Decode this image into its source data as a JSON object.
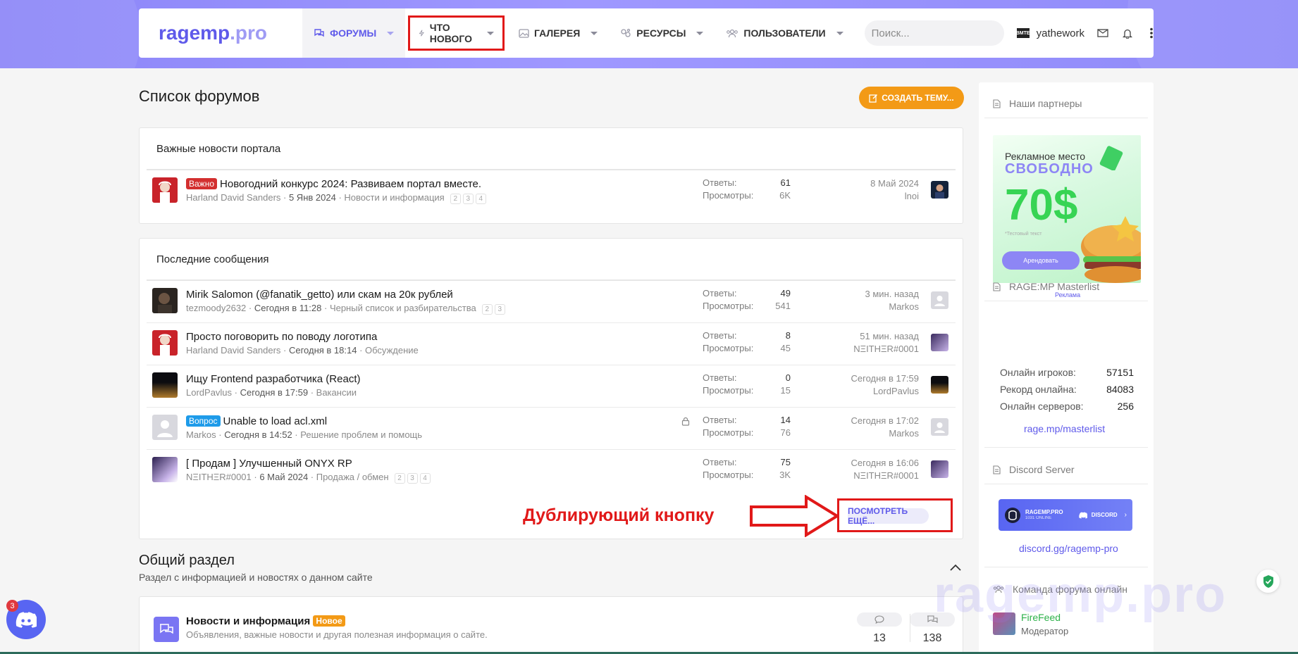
{
  "brand": {
    "logo_main": "ragemp",
    "logo_dot": ".pro",
    "accent": "#5f5aea",
    "orange": "#f39a16",
    "annotation_red": "#e11919"
  },
  "nav": {
    "items": [
      {
        "label": "ФОРУМЫ",
        "icon": "forums-icon"
      },
      {
        "label": "ЧТО НОВОГО",
        "icon": "lightning-icon"
      },
      {
        "label": "ГАЛЕРЕЯ",
        "icon": "gallery-icon"
      },
      {
        "label": "РЕСУРСЫ",
        "icon": "resources-icon"
      },
      {
        "label": "ПОЛЬЗОВАТЕЛИ",
        "icon": "users-icon"
      }
    ],
    "search_placeholder": "Поиск...",
    "username": "yathework",
    "user_avatar_text": "BMTE"
  },
  "page": {
    "title": "Список форумов",
    "create_button": "СОЗДАТЬ ТЕМУ..."
  },
  "important": {
    "heading": "Важные новости портала",
    "rows": [
      {
        "badge": "Важно",
        "title": "Новогодний конкурс 2024: Развиваем портал вместе.",
        "author": "Harland David Sanders",
        "date": "5 Янв 2024",
        "forum": "Новости и информация",
        "pages": [
          "2",
          "3",
          "4"
        ],
        "replies_label": "Ответы:",
        "replies": "61",
        "views_label": "Просмотры:",
        "views": "6K",
        "last_date": "8 Май 2024",
        "last_user": "lnoi"
      }
    ]
  },
  "latest": {
    "heading": "Последние сообщения",
    "rows": [
      {
        "badge": "",
        "title": "Mirik Salomon (@fanatik_getto) или скам на 20к рублей",
        "author": "tezmoody2632",
        "date": "Сегодня в 11:28",
        "forum": "Черный список и разбирательства",
        "pages": [
          "2",
          "3"
        ],
        "replies_label": "Ответы:",
        "replies": "49",
        "views_label": "Просмотры:",
        "views": "541",
        "last_date": "3 мин. назад",
        "last_user": "Markos"
      },
      {
        "badge": "",
        "title": "Просто поговорить по поводу логотипа",
        "author": "Harland David Sanders",
        "date": "Сегодня в 18:14",
        "forum": "Обсуждение",
        "pages": [],
        "replies_label": "Ответы:",
        "replies": "8",
        "views_label": "Просмотры:",
        "views": "45",
        "last_date": "51 мин. назад",
        "last_user": "NΞITHΞR#0001"
      },
      {
        "badge": "",
        "title": "Ищу Frontend разработчика (React)",
        "author": "LordPavlus",
        "date": "Сегодня в 17:59",
        "forum": "Вакансии",
        "pages": [],
        "replies_label": "Ответы:",
        "replies": "0",
        "views_label": "Просмотры:",
        "views": "15",
        "last_date": "Сегодня в 17:59",
        "last_user": "LordPavlus"
      },
      {
        "badge": "Вопрос",
        "title": "Unable to load acl.xml",
        "author": "Markos",
        "date": "Сегодня в 14:52",
        "forum": "Решение проблем и помощь",
        "pages": [],
        "replies_label": "Ответы:",
        "replies": "14",
        "views_label": "Просмотры:",
        "views": "76",
        "last_date": "Сегодня в 17:02",
        "last_user": "Markos"
      },
      {
        "badge": "",
        "title": "[ Продам ] Улучшенный ONYX RP",
        "author": "NΞITHΞR#0001",
        "date": "6 Май 2024",
        "forum": "Продажа / обмен",
        "pages": [
          "2",
          "3",
          "4"
        ],
        "replies_label": "Ответы:",
        "replies": "75",
        "views_label": "Просмотры:",
        "views": "3K",
        "last_date": "Сегодня в 16:06",
        "last_user": "NΞITHΞR#0001"
      }
    ],
    "more_button": "ПОСМОТРЕТЬ ЕЩЁ..."
  },
  "annotation": {
    "text": "Дублирующий кнопку"
  },
  "section": {
    "title": "Общий раздел",
    "description": "Раздел с информацией и новостях о данном сайте",
    "forums": [
      {
        "title": "Новости и информация",
        "badge": "Новое",
        "description": "Объявления, важные новости и другая полезная информация о сайте.",
        "threads": "13",
        "messages": "138"
      }
    ]
  },
  "sidebar": {
    "partners": {
      "heading": "Наши партнеры",
      "ad_line1": "Рекламное место",
      "ad_line2": "СВОБОДНО",
      "ad_price": "70$",
      "ad_small": "*Тестовый текст",
      "ad_button": "Арендовать",
      "ad_label": "Реклама"
    },
    "masterlist": {
      "heading": "RAGE:MP Masterlist",
      "rows": [
        {
          "label": "Онлайн игроков:",
          "value": "57151"
        },
        {
          "label": "Рекорд онлайна:",
          "value": "84083"
        },
        {
          "label": "Онлайн серверов:",
          "value": "256"
        }
      ],
      "link": "rage.mp/masterlist"
    },
    "discord": {
      "heading": "Discord Server",
      "banner_name": "RAGEMP.PRO",
      "banner_online": "1031 ONLINE",
      "banner_brand": "DISCORD",
      "link": "discord.gg/ragemp-pro"
    },
    "team": {
      "heading": "Команда форума онлайн",
      "members": [
        {
          "name": "FireFeed",
          "role": "Модератор"
        }
      ]
    }
  },
  "watermark": "ragemp.pro",
  "discord_float": {
    "count": "3"
  }
}
